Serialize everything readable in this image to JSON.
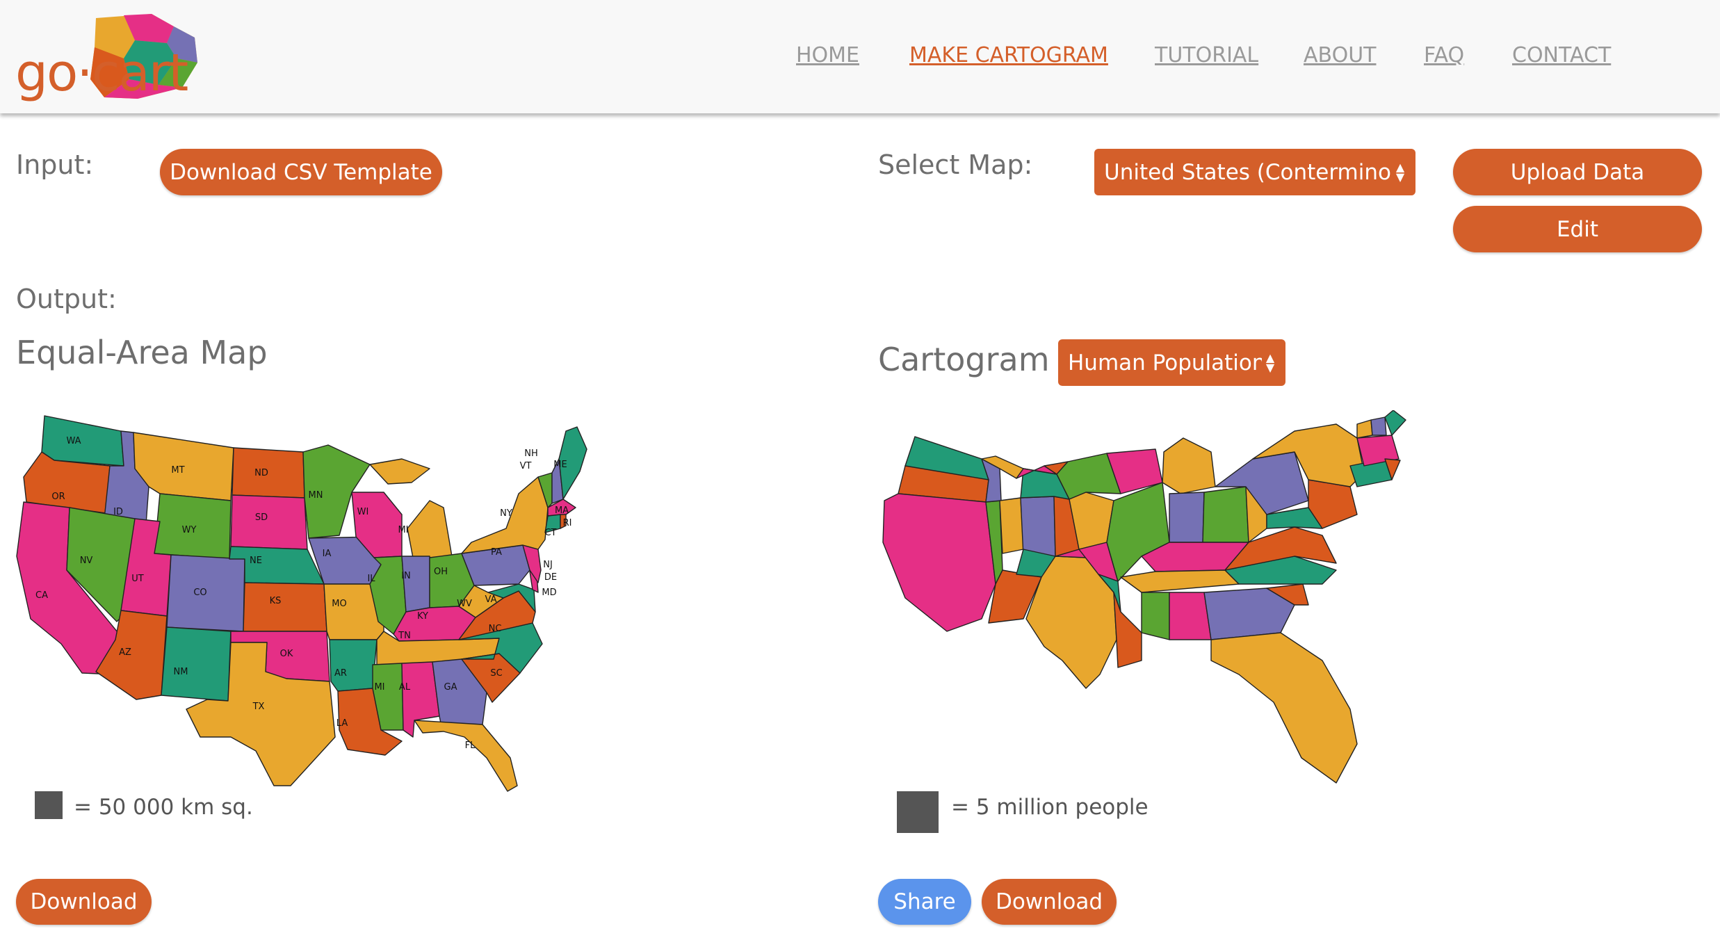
{
  "colors": {
    "accent": "#d45f2a",
    "share": "#5b94ec",
    "palette": [
      "#e8a72e",
      "#d9591d",
      "#e52f86",
      "#5aa532",
      "#229b77",
      "#7571b4"
    ]
  },
  "logo": {
    "text": "go·cart"
  },
  "nav": {
    "items": [
      {
        "label": "HOME"
      },
      {
        "label": "MAKE CARTOGRAM",
        "active": true
      },
      {
        "label": "TUTORIAL"
      },
      {
        "label": "ABOUT"
      },
      {
        "label": "FAQ"
      },
      {
        "label": "CONTACT"
      }
    ]
  },
  "input": {
    "label": "Input:",
    "download_csv_label": "Download CSV Template"
  },
  "select_map": {
    "label": "Select Map:",
    "value": "United States (Conterminous)",
    "upload_label": "Upload Data",
    "edit_label": "Edit"
  },
  "output": {
    "label": "Output:"
  },
  "equal_area": {
    "title": "Equal-Area Map",
    "legend": "= 50 000 km sq.",
    "download_label": "Download",
    "states": [
      "WA",
      "MT",
      "ND",
      "NH",
      "VT",
      "ME",
      "OR",
      "ID",
      "MN",
      "MA",
      "SD",
      "WI",
      "NY",
      "RI",
      "WY",
      "MI",
      "CT",
      "NV",
      "NE",
      "IA",
      "PA",
      "NJ",
      "UT",
      "IL",
      "IN",
      "OH",
      "DE",
      "CA",
      "CO",
      "KS",
      "MO",
      "WV",
      "MD",
      "VA",
      "KY",
      "NC",
      "TN",
      "AZ",
      "OK",
      "NM",
      "AR",
      "SC",
      "MI",
      "AL",
      "GA",
      "TX",
      "LA",
      "FL"
    ]
  },
  "cartogram": {
    "title": "Cartogram",
    "dataset_value": "Human Population",
    "legend": "= 5 million people",
    "share_label": "Share",
    "download_label": "Download"
  }
}
